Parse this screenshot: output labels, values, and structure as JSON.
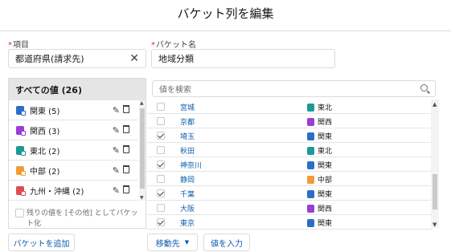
{
  "dialog": {
    "title": "バケット列を編集"
  },
  "colors": {
    "kanto": "#2c6ec7",
    "kansai": "#9b3dd6",
    "tohoku": "#1c9a94",
    "chubu": "#f29b38",
    "kyushu": "#e04b54",
    "link": "#0b5cab",
    "required": "#c23934"
  },
  "form": {
    "item_label": "項目",
    "item_required_mark": "*",
    "item_value": "都道府県(請求先)",
    "bucket_name_label": "バケット名",
    "bucket_name_required_mark": "*",
    "bucket_name_value": "地域分類"
  },
  "left_panel": {
    "header": "すべての値 (26)",
    "buckets": [
      {
        "label": "関東 (5)",
        "icon": "bucket-icon",
        "color": "#2c6ec7"
      },
      {
        "label": "関西 (3)",
        "icon": "bucket-icon",
        "color": "#9b3dd6"
      },
      {
        "label": "東北 (2)",
        "icon": "bucket-icon",
        "color": "#1c9a94"
      },
      {
        "label": "中部 (2)",
        "icon": "bucket-icon",
        "color": "#f29b38"
      },
      {
        "label": "九州・沖縄 (2)",
        "icon": "bucket-icon",
        "color": "#e04b54"
      }
    ],
    "others_checkbox_label": "残りの値を [その他] としてバケット化"
  },
  "right_panel": {
    "search_placeholder": "値を検索",
    "rows": [
      {
        "value": "宮城",
        "checked": false,
        "bucket": "東北",
        "color": "#1c9a94"
      },
      {
        "value": "京都",
        "checked": false,
        "bucket": "関西",
        "color": "#9b3dd6"
      },
      {
        "value": "埼玉",
        "checked": true,
        "bucket": "関東",
        "color": "#2c6ec7"
      },
      {
        "value": "秋田",
        "checked": false,
        "bucket": "東北",
        "color": "#1c9a94"
      },
      {
        "value": "神奈川",
        "checked": true,
        "bucket": "関東",
        "color": "#2c6ec7"
      },
      {
        "value": "静岡",
        "checked": false,
        "bucket": "中部",
        "color": "#f29b38"
      },
      {
        "value": "千葉",
        "checked": true,
        "bucket": "関東",
        "color": "#2c6ec7"
      },
      {
        "value": "大阪",
        "checked": false,
        "bucket": "関西",
        "color": "#9b3dd6"
      },
      {
        "value": "東京",
        "checked": true,
        "bucket": "関東",
        "color": "#2c6ec7"
      }
    ]
  },
  "buttons": {
    "add_bucket": "バケットを追加",
    "move_to": "移動先",
    "enter_value": "値を入力"
  }
}
